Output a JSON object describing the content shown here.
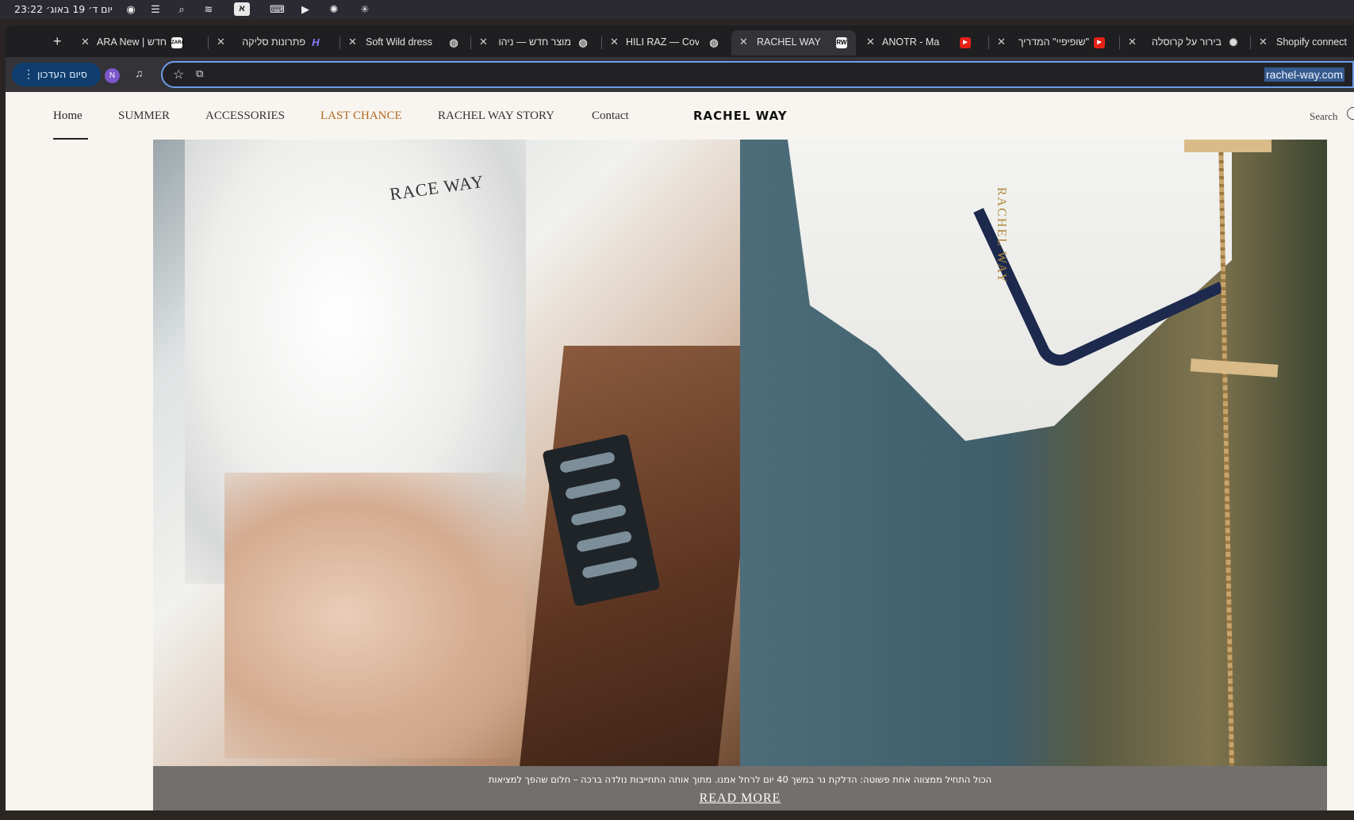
{
  "menubar": {
    "clock": "23:22 יום ד׳ 19 באוג׳",
    "keyboard_lang": "א",
    "icons": [
      "chrome-icon",
      "control-center-icon",
      "search-icon",
      "wifi-icon",
      "keyboard-icon",
      "display-icon",
      "play-icon",
      "openai-icon",
      "claude-icon"
    ]
  },
  "tabs": [
    {
      "title": "Shopify connect",
      "icon": "openai-icon"
    },
    {
      "title": "בירור על קרוסלה",
      "icon": "openai-icon"
    },
    {
      "title": "\"שופיפיי\" המדריך",
      "icon": "youtube-icon"
    },
    {
      "title": "ANOTR - Ma",
      "icon": "youtube-icon"
    },
    {
      "title": "RACHEL WAY",
      "icon": "rw-icon",
      "fav_text": "RW"
    },
    {
      "title": "HILI RAZ — Cove",
      "icon": "globe-icon"
    },
    {
      "title": "מוצר חדש — ניהו",
      "icon": "globe-icon"
    },
    {
      "title": "Soft Wild dress",
      "icon": "globe-icon"
    },
    {
      "title": "פתרונות סליקה",
      "icon": "h-icon",
      "fav_text": "H"
    },
    {
      "title": "חדש | ZARA New",
      "icon": "zara-icon",
      "fav_text": "ZARA"
    }
  ],
  "toolbar": {
    "end_session": "סיום העדכון",
    "avatar_letter": "N",
    "url": "rachel-way.com"
  },
  "nav": {
    "items": [
      "Home",
      "SUMMER",
      "ACCESSORIES",
      "LAST CHANCE",
      "RACHEL WAY STORY",
      "Contact"
    ],
    "logo": "RACHEL WAY",
    "search": "Search"
  },
  "hero": {
    "robe_text": "RACE WAY",
    "shirt_text": "RACHEL WAY",
    "caption": "הכול התחיל ממצווה אחת פשוטה: הדלקת נר במשך 40 יום לרחל אמנו. מתוך אותה התחייבות נולדה ברכה – חלום שהפך למציאות",
    "read_more": "READ MORE"
  },
  "colors": {
    "accent_last_chance": "#b3651c",
    "omnibox_focus": "#6d9ee8",
    "end_session_bg": "#0f3e6e"
  }
}
